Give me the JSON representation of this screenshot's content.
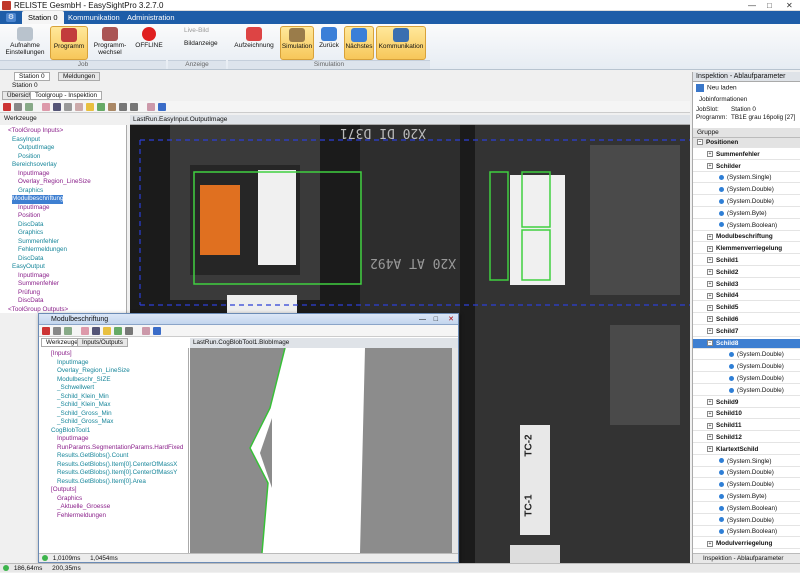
{
  "app": {
    "title": "RELISTE GesmbH - EasySightPro 3.2.7.0"
  },
  "menu": {
    "items": [
      "Station 0",
      "Kommunikation",
      "Administration"
    ]
  },
  "ribbon": {
    "buttons": [
      {
        "label": "Aufnahme Einstellungen"
      },
      {
        "label": "Programm"
      },
      {
        "label": "Programm-wechsel"
      },
      {
        "label": "OFFLINE"
      },
      {
        "label": "Live-Bild"
      },
      {
        "label": "Bildanzeige"
      },
      {
        "label": "Aufzeichnung"
      },
      {
        "label": "Simulation"
      },
      {
        "label": "Zurück"
      },
      {
        "label": "Nächstes"
      },
      {
        "label": "Kommunikation"
      }
    ],
    "groups": [
      "Job",
      "Anzeige",
      "Simulation"
    ]
  },
  "doc_tabs": [
    "Station 0",
    "Meldungen"
  ],
  "station_label": "Station 0",
  "sub_tabs": [
    "Übersicht",
    "Toolgroup - Inspektion"
  ],
  "left": {
    "werkzeuge_tab": "Werkzeuge",
    "image_caption": "LastRun.EasyInput.OutputImage",
    "tree": [
      {
        "text": "<ToolGroup Inputs>",
        "cls": "purple"
      },
      {
        "text": "EasyInput",
        "cls": "cyan"
      },
      {
        "text": "OutputImage",
        "cls": "cyan"
      },
      {
        "text": "Position",
        "cls": "cyan"
      },
      {
        "text": "Bereichsoverlay",
        "cls": "cyan"
      },
      {
        "text": "InputImage",
        "cls": "purple"
      },
      {
        "text": "Overlay_Region_LineSize",
        "cls": "purple"
      },
      {
        "text": "Graphics",
        "cls": "cyan"
      },
      {
        "text": "Modulbeschriftung",
        "cls": "sel"
      },
      {
        "text": "InputImage",
        "cls": "purple"
      },
      {
        "text": "Position",
        "cls": "purple"
      },
      {
        "text": "DiscData",
        "cls": "cyan"
      },
      {
        "text": "Graphics",
        "cls": "cyan"
      },
      {
        "text": "Summenfehler",
        "cls": "cyan"
      },
      {
        "text": "Fehlermeldungen",
        "cls": "cyan"
      },
      {
        "text": "DiscData",
        "cls": "cyan"
      },
      {
        "text": "EasyOutput",
        "cls": "cyan"
      },
      {
        "text": "InputImage",
        "cls": "purple"
      },
      {
        "text": "Summenfehler",
        "cls": "purple"
      },
      {
        "text": "Prüfung",
        "cls": "purple"
      },
      {
        "text": "DiscData",
        "cls": "purple"
      },
      {
        "text": "<ToolGroup Outputs>",
        "cls": "purple"
      }
    ]
  },
  "modul": {
    "title": "Modulbeschriftung",
    "tabs": [
      "Werkzeuge",
      "Inputs/Outputs"
    ],
    "image_caption": "LastRun.CogBlobTool1.BlobImage",
    "status": [
      "1,0109ms",
      "1,0454ms"
    ],
    "tree": [
      {
        "text": "[Inputs]",
        "cls": "purple"
      },
      {
        "text": "InputImage",
        "cls": "cyan"
      },
      {
        "text": "Overlay_Region_LineSize",
        "cls": "cyan"
      },
      {
        "text": "Modulbeschr_SIZE",
        "cls": "cyan"
      },
      {
        "text": "_Schwellwert",
        "cls": "cyan"
      },
      {
        "text": "_Schild_Klein_Min",
        "cls": "cyan"
      },
      {
        "text": "_Schild_Klein_Max",
        "cls": "cyan"
      },
      {
        "text": "_Schild_Gross_Min",
        "cls": "cyan"
      },
      {
        "text": "_Schild_Gross_Max",
        "cls": "cyan"
      },
      {
        "text": "CogBlobTool1",
        "cls": "cyan"
      },
      {
        "text": "InputImage",
        "cls": "purple"
      },
      {
        "text": "RunParams.SegmentationParams.HardFixed",
        "cls": "purple"
      },
      {
        "text": "Results.GetBlobs().Count",
        "cls": "cyan"
      },
      {
        "text": "Results.GetBlobs().Item[0].CenterOfMassX",
        "cls": "cyan"
      },
      {
        "text": "Results.GetBlobs().Item[0].CenterOfMassY",
        "cls": "cyan"
      },
      {
        "text": "Results.GetBlobs().Item[0].Area",
        "cls": "cyan"
      },
      {
        "text": "[Outputs]",
        "cls": "purple"
      },
      {
        "text": "Graphics",
        "cls": "purple"
      },
      {
        "text": "_Aktuelle_Groesse",
        "cls": "purple"
      },
      {
        "text": "Fehlermeldungen",
        "cls": "purple"
      }
    ]
  },
  "image_labels": {
    "top": "X20 DI D371",
    "mid": "X20 AT A492",
    "tc2": "TC-2",
    "tc1": "TC-1"
  },
  "right": {
    "header": "Inspektion - Ablaufparameter",
    "reload": "Neu laden",
    "info_title": "Jobinformationen",
    "jobslot_label": "JobSlot:",
    "jobslot_value": "Station 0",
    "programm_label": "Programm:",
    "programm_value": "TB1E grau 16polig [27]",
    "gruppe_header": "Gruppe",
    "rows": [
      {
        "text": "Positionen",
        "kind": "grp"
      },
      {
        "text": "Summenfehler",
        "kind": "exp"
      },
      {
        "text": "Schilder",
        "kind": "exp"
      },
      {
        "text": "(System.Single)",
        "kind": "val"
      },
      {
        "text": "(System.Double)",
        "kind": "val"
      },
      {
        "text": "(System.Double)",
        "kind": "val"
      },
      {
        "text": "(System.Byte)",
        "kind": "val"
      },
      {
        "text": "(System.Boolean)",
        "kind": "val"
      },
      {
        "text": "Modulbeschriftung",
        "kind": "exp"
      },
      {
        "text": "Klemmenverriegelung",
        "kind": "exp"
      },
      {
        "text": "Schild1",
        "kind": "exp"
      },
      {
        "text": "Schild2",
        "kind": "exp"
      },
      {
        "text": "Schild3",
        "kind": "exp"
      },
      {
        "text": "Schild4",
        "kind": "exp"
      },
      {
        "text": "Schild5",
        "kind": "exp"
      },
      {
        "text": "Schild6",
        "kind": "exp"
      },
      {
        "text": "Schild7",
        "kind": "exp"
      },
      {
        "text": "Schild8",
        "kind": "sel"
      },
      {
        "text": "(System.Double)",
        "kind": "val2"
      },
      {
        "text": "(System.Double)",
        "kind": "val2"
      },
      {
        "text": "(System.Double)",
        "kind": "val2"
      },
      {
        "text": "(System.Double)",
        "kind": "val2"
      },
      {
        "text": "Schild9",
        "kind": "exp"
      },
      {
        "text": "Schild10",
        "kind": "exp"
      },
      {
        "text": "Schild11",
        "kind": "exp"
      },
      {
        "text": "Schild12",
        "kind": "exp"
      },
      {
        "text": "KlartextSchild",
        "kind": "exp"
      },
      {
        "text": "(System.Single)",
        "kind": "val"
      },
      {
        "text": "(System.Double)",
        "kind": "val"
      },
      {
        "text": "(System.Double)",
        "kind": "val"
      },
      {
        "text": "(System.Byte)",
        "kind": "val"
      },
      {
        "text": "(System.Boolean)",
        "kind": "val"
      },
      {
        "text": "(System.Double)",
        "kind": "val"
      },
      {
        "text": "(System.Boolean)",
        "kind": "val"
      },
      {
        "text": "Modulverriegelung",
        "kind": "exp"
      }
    ],
    "footer": "Inspektion - Ablaufparameter"
  },
  "statusbar": {
    "left": "186,64ms",
    "right": "200,35ms"
  }
}
